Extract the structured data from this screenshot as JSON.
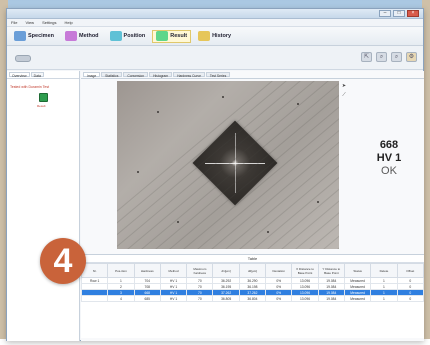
{
  "window": {
    "title": ""
  },
  "menu": [
    "File",
    "View",
    "Settings",
    "Help"
  ],
  "toolbar": [
    {
      "label": "Specimen",
      "color": "#6a9ed8"
    },
    {
      "label": "Method",
      "color": "#c77ad8"
    },
    {
      "label": "Position",
      "color": "#5fc1d6"
    },
    {
      "label": "Result",
      "color": "#5fd68a",
      "active": true
    },
    {
      "label": "History",
      "color": "#e6c65a"
    }
  ],
  "left_tabs": [
    "Overview",
    "Data"
  ],
  "tree": {
    "title": "Tested with Duramin Test",
    "item": "Result"
  },
  "main_tabs": [
    "Image",
    "Statistics",
    "Conversion",
    "Histogram",
    "Hardness Curve",
    "Test Series"
  ],
  "result": {
    "value": "668",
    "scale": "HV 1",
    "status": "OK"
  },
  "table": {
    "title": "Table",
    "headers": [
      "Nr.",
      "Pos-ition",
      "Hardness",
      "Method",
      "Maximum hardness",
      "d1[µm]",
      "d2[µm]",
      "Deviation",
      "X Distance to Base Point",
      "Y Distance to Base Point",
      "Status",
      "Delete",
      "Offset"
    ],
    "rows": [
      [
        "Row 1",
        "1",
        "704",
        "HV 1",
        "70",
        "36.292",
        "36.290",
        "0%",
        "13.096",
        "19.084",
        "Measured",
        "1",
        "0"
      ],
      [
        "",
        "2",
        "708",
        "HV 1",
        "70",
        "36.195",
        "36.198",
        "0%",
        "13.096",
        "19.084",
        "Measured",
        "1",
        "0"
      ],
      [
        "",
        "3",
        "668",
        "HV 1",
        "70",
        "37.262",
        "37.262",
        "0%",
        "13.096",
        "19.084",
        "Measured",
        "1",
        "0"
      ],
      [
        "",
        "4",
        "685",
        "HV 1",
        "70",
        "36.805",
        "36.804",
        "0%",
        "13.096",
        "19.084",
        "Measured",
        "1",
        "0"
      ]
    ],
    "selected_row": 2
  },
  "step_badge": "4"
}
